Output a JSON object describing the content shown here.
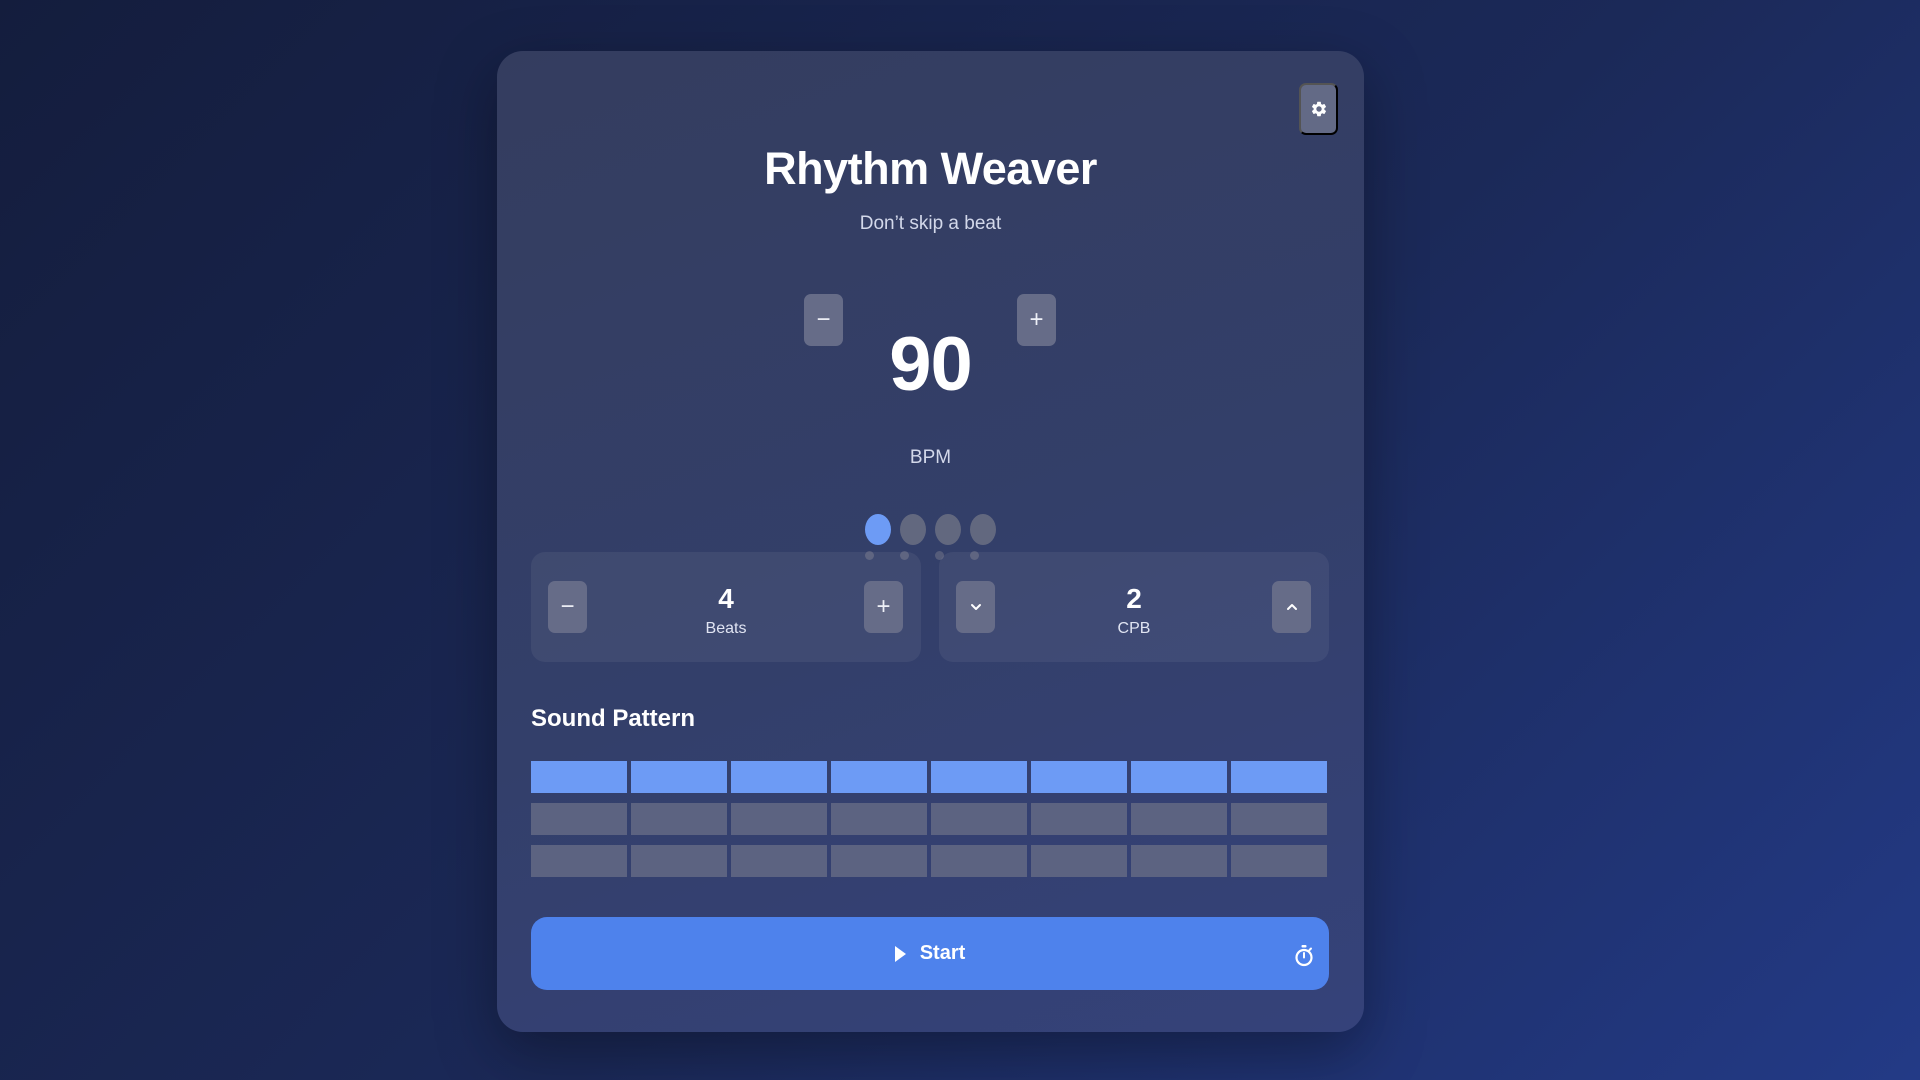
{
  "app": {
    "title": "Rhythm Weaver",
    "subtitle": "Don’t skip a beat"
  },
  "icons": {
    "settings": "gear-icon",
    "bpm_decrease": "minus-icon",
    "bpm_increase": "plus-icon",
    "beats_decrease": "minus-icon",
    "beats_increase": "plus-icon",
    "cpb_decrease": "chevron-down-icon",
    "cpb_increase": "chevron-up-icon",
    "play": "play-icon",
    "timer": "stopwatch-icon"
  },
  "tempo": {
    "bpm": "90",
    "label": "BPM",
    "decrease_symbol": "−",
    "increase_symbol": "+"
  },
  "beat_indicator": {
    "count": 4,
    "active_index": 0
  },
  "beats": {
    "value": "4",
    "label": "Beats",
    "decrease_symbol": "−",
    "increase_symbol": "+"
  },
  "cpb": {
    "value": "2",
    "label": "CPB"
  },
  "sound_pattern": {
    "title": "Sound Pattern",
    "rows": [
      [
        true,
        true,
        true,
        true,
        true,
        true,
        true,
        true
      ],
      [
        false,
        false,
        false,
        false,
        false,
        false,
        false,
        false
      ],
      [
        false,
        false,
        false,
        false,
        false,
        false,
        false,
        false
      ]
    ]
  },
  "start_button": {
    "label": "Start"
  },
  "colors": {
    "accent": "#4e82ec",
    "active": "#6d9bf5",
    "inactive": "#5c6381"
  }
}
